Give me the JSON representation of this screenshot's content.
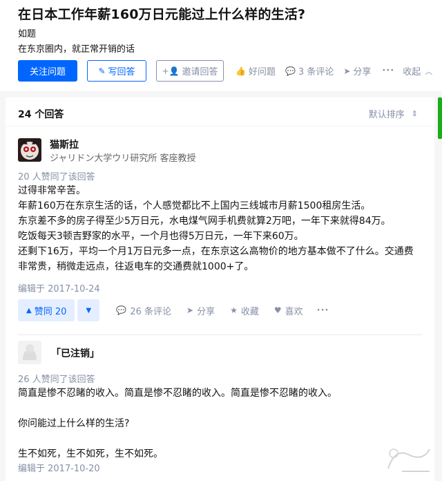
{
  "question": {
    "title": "在日本工作年薪160万日元能过上什么样的生活?",
    "topic": "如题",
    "description": "在东京圈内，就正常开销的话"
  },
  "actions": {
    "follow": "关注问题",
    "write": "写回答",
    "invite": "邀请回答",
    "good_question": "好问题",
    "comments": "3 条评论",
    "share": "分享",
    "more": "···",
    "fold": "收起"
  },
  "answers_header": {
    "count": "24 个回答",
    "sort": "默认排序"
  },
  "answers": [
    {
      "author": "猫斯拉",
      "headline": "ジャリドン大学ウリ研究所 客座教授",
      "votes_text": "20 人赞同了该回答",
      "paragraphs": [
        "过得非常辛苦。",
        "年薪160万在东京生活的话，个人感觉都比不上国内三线城市月薪1500租房生活。",
        "东京差不多的房子得至少5万日元，水电煤气网手机费就算2万吧，一年下来就得84万。",
        "吃饭每天3顿吉野家的水平，一个月也得5万日元，一年下来60万。",
        "还剩下16万，平均一个月1万日元多一点，在东京这么高物价的地方基本做不了什么。交通费非常贵，稍微走远点，往返电车的交通费就1000+了。"
      ],
      "edited": "编辑于 2017-10-24",
      "vote_label": "赞同 20",
      "comments": "26 条评论",
      "share": "分享",
      "collect": "收藏",
      "like": "喜欢",
      "more": "···"
    },
    {
      "author": "「已注销」",
      "votes_text": "26 人赞同了该回答",
      "paragraphs": [
        "简直是惨不忍睹的收入。简直是惨不忍睹的收入。简直是惨不忍睹的收入。",
        "",
        "你问能过上什么样的生活?",
        "",
        "生不如死，生不如死，生不如死。"
      ],
      "edited": "编辑于 2017-10-20"
    }
  ],
  "colors": {
    "brand": "#0066ff",
    "meta": "#8590a6",
    "vote_bg": "#e5eeff",
    "side_accent": "#1aad19"
  },
  "icons": {
    "write": "pencil-icon",
    "invite": "add-user-icon",
    "good_question": "thumbs-up-icon",
    "comments": "speech-bubble-icon",
    "share": "paper-plane-icon",
    "fold": "chevron-up-icon",
    "sort": "sort-arrows-icon",
    "collect": "star-icon",
    "like": "heart-icon"
  }
}
